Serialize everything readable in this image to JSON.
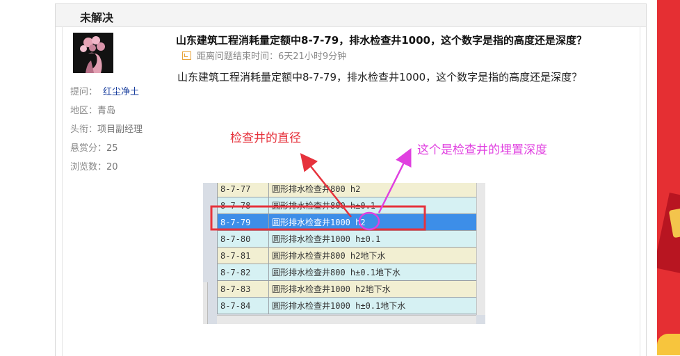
{
  "section": {
    "status_title": "未解决"
  },
  "asker": {
    "label_asker": "提问：",
    "name": "红尘净土",
    "region_label": "地区：",
    "region": "青岛",
    "title_label": "头衔：",
    "title": "项目副经理",
    "bounty_label": "悬赏分：",
    "bounty": "25",
    "views_label": "浏览数：",
    "views": "20"
  },
  "question": {
    "title": "山东建筑工程消耗量定额中8-7-79，排水检查井1000，这个数字是指的高度还是深度？",
    "timer_label": "距离问题结束时间：",
    "timer_value": "6天21小时9分钟",
    "body": "山东建筑工程消耗量定额中8-7-79，排水检查井1000，这个数字是指的高度还是深度？"
  },
  "annotations": {
    "diameter_note": "检查井的直径",
    "depth_note": "这个是检查井的埋置深度"
  },
  "screenshot_table": {
    "rows": [
      {
        "code": "8-7-77",
        "name": "圆形排水检查井800 h2",
        "tone": "y"
      },
      {
        "code": "8-7-78",
        "name": "圆形排水检查井800 h±0.1",
        "tone": "b"
      },
      {
        "code": "8-7-79",
        "name": "圆形排水检查井1000 h2",
        "tone": "sel"
      },
      {
        "code": "8-7-80",
        "name": "圆形排水检查井1000 h±0.1",
        "tone": "b"
      },
      {
        "code": "8-7-81",
        "name": "圆形排水检查井800 h2地下水",
        "tone": "y"
      },
      {
        "code": "8-7-82",
        "name": "圆形排水检查井800 h±0.1地下水",
        "tone": "b"
      },
      {
        "code": "8-7-83",
        "name": "圆形排水检查井1000 h2地下水",
        "tone": "y"
      },
      {
        "code": "8-7-84",
        "name": "圆形排水检查井1000 h±0.1地下水",
        "tone": "b"
      }
    ]
  },
  "colors": {
    "red_annotation": "#e6323c",
    "magenta_annotation": "#e040e0",
    "selection_blue": "#3d8ee8",
    "banner_red": "#e52f33"
  }
}
